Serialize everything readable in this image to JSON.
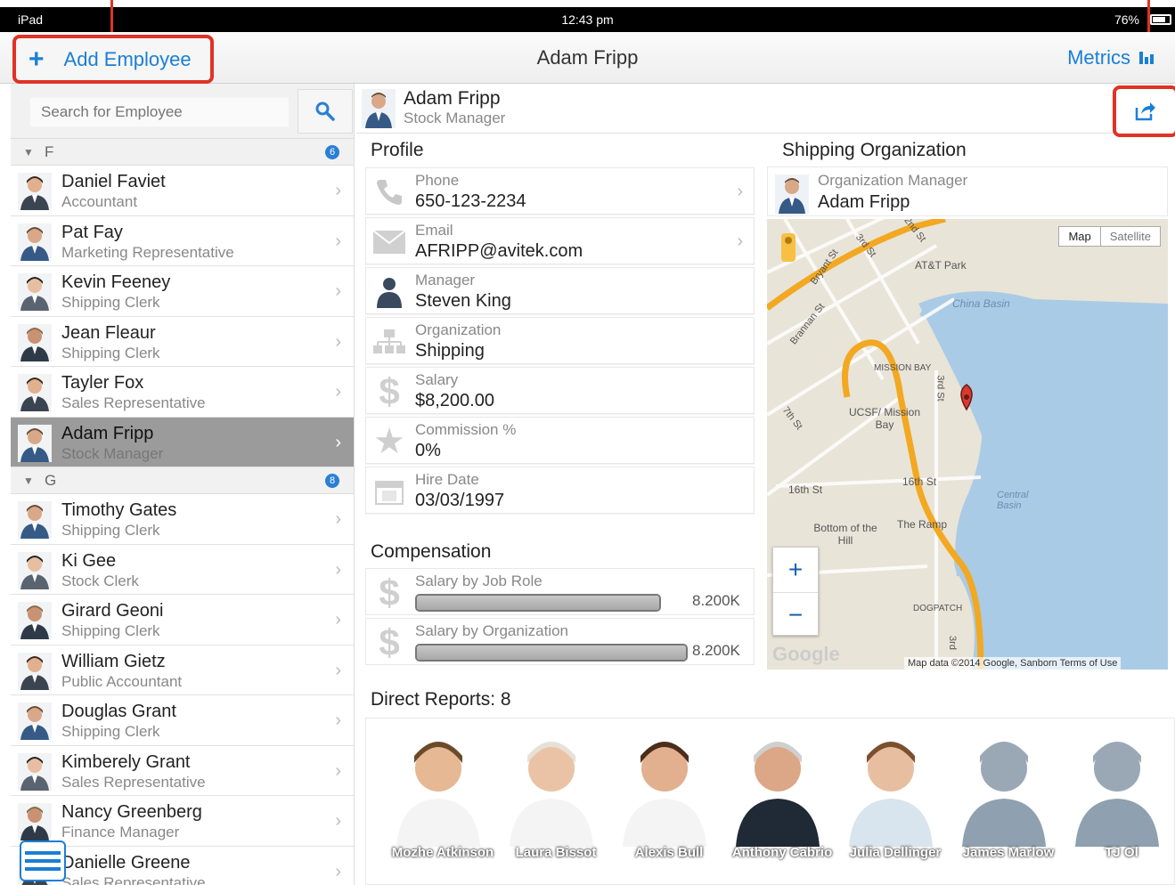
{
  "status_bar": {
    "device": "iPad",
    "time": "12:43 pm",
    "battery": "76%"
  },
  "toolbar": {
    "add_label": "Add Employee",
    "title": "Adam Fripp",
    "metrics_label": "Metrics"
  },
  "search": {
    "placeholder": "Search for Employee"
  },
  "groups": [
    {
      "letter": "F",
      "count": "6",
      "employees": [
        {
          "name": "Daniel Faviet",
          "role": "Accountant"
        },
        {
          "name": "Pat Fay",
          "role": "Marketing Representative"
        },
        {
          "name": "Kevin Feeney",
          "role": "Shipping Clerk"
        },
        {
          "name": "Jean Fleaur",
          "role": "Shipping Clerk"
        },
        {
          "name": "Tayler Fox",
          "role": "Sales Representative"
        },
        {
          "name": "Adam Fripp",
          "role": "Stock Manager"
        }
      ]
    },
    {
      "letter": "G",
      "count": "8",
      "employees": [
        {
          "name": "Timothy Gates",
          "role": "Shipping Clerk"
        },
        {
          "name": "Ki Gee",
          "role": "Stock Clerk"
        },
        {
          "name": "Girard Geoni",
          "role": "Shipping Clerk"
        },
        {
          "name": "William Gietz",
          "role": "Public Accountant"
        },
        {
          "name": "Douglas Grant",
          "role": "Shipping Clerk"
        },
        {
          "name": "Kimberely Grant",
          "role": "Sales Representative"
        },
        {
          "name": "Nancy Greenberg",
          "role": "Finance Manager"
        },
        {
          "name": "Danielle Greene",
          "role": "Sales Representative"
        }
      ]
    }
  ],
  "person": {
    "name": "Adam Fripp",
    "role": "Stock Manager"
  },
  "profile": {
    "title": "Profile",
    "phone_label": "Phone",
    "phone": "650-123-2234",
    "email_label": "Email",
    "email": "AFRIPP@avitek.com",
    "manager_label": "Manager",
    "manager": "Steven King",
    "org_label": "Organization",
    "org": "Shipping",
    "salary_label": "Salary",
    "salary": "$8,200.00",
    "commission_label": "Commission %",
    "commission": "0%",
    "hire_label": "Hire Date",
    "hire": "03/03/1997"
  },
  "compensation": {
    "title": "Compensation",
    "job_role_label": "Salary by Job Role",
    "job_role_value": "8.200K",
    "job_role_fill": 1.0,
    "org_label": "Salary by Organization",
    "org_value": "8.200K",
    "org_fill": 1.0
  },
  "shipping": {
    "title": "Shipping Organization",
    "mgr_label": "Organization Manager",
    "mgr_name": "Adam Fripp"
  },
  "map": {
    "btn_map": "Map",
    "btn_satellite": "Satellite",
    "labels": [
      "AT&T Park",
      "China Basin",
      "MISSION BAY",
      "UCSF/ Mission Bay",
      "16th St",
      "16th St",
      "Central Basin",
      "Bottom of the Hill",
      "The Ramp",
      "DOGPATCH",
      "Brannan St",
      "Bryant St",
      "3rd St",
      "2nd St",
      "7th St",
      "3rd St",
      "3rd"
    ],
    "footer": "Map data ©2014 Google, Sanborn    Terms of Use",
    "google": "Google"
  },
  "reports": {
    "title": "Direct Reports: 8",
    "people": [
      "Mozhe Atkinson",
      "Laura Bissot",
      "Alexis Bull",
      "Anthony Cabrio",
      "Julia Dellinger",
      "James Marlow",
      "TJ Ol"
    ]
  },
  "colors": {
    "accent": "#1a7fd6",
    "highlight": "#e03225",
    "selected_row": "#9b9b9b"
  }
}
